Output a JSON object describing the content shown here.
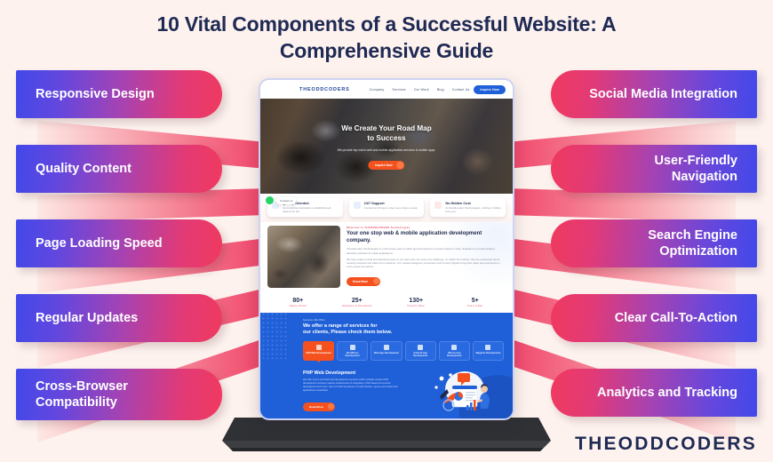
{
  "background_color": "#fdf2ee",
  "accent_blue": "#4248ea",
  "accent_pink": "#f03a5f",
  "title": "10 Vital Components of a Successful Website: A Comprehensive Guide",
  "brand": "THEODDCODERS",
  "left_items": [
    {
      "label": "Responsive Design"
    },
    {
      "label": "Quality Content"
    },
    {
      "label": "Page Loading Speed"
    },
    {
      "label": "Regular Updates"
    },
    {
      "label": "Cross-Browser Compatibility"
    }
  ],
  "right_items": [
    {
      "label": "Social Media Integration"
    },
    {
      "label": "User-Friendly Navigation"
    },
    {
      "label": "Search Engine Optimization"
    },
    {
      "label": "Clear Call-To-Action"
    },
    {
      "label": "Analytics and Tracking"
    }
  ],
  "mockup": {
    "site_logo": "THEODDCODERS",
    "nav": [
      {
        "label": "Company"
      },
      {
        "label": "Services"
      },
      {
        "label": "Our Work"
      },
      {
        "label": "Blog"
      },
      {
        "label": "Contact Us"
      }
    ],
    "nav_button": "Inquire Now",
    "hero": {
      "heading_line1": "We Create Your Road Map",
      "heading_line2": "to Success",
      "subtext": "We provide top notch web and mobile application services & mobile apps.",
      "cta": "Inquire Now"
    },
    "whatsapp_label": "Contact us",
    "cards": [
      {
        "title": "Quality Oriented",
        "text": "Accomplished standards in establishing all aspects for the."
      },
      {
        "title": "24/7 Support",
        "text": "Contact us 24 hours a day, seven days a week."
      },
      {
        "title": "No Hidden Cost",
        "text": "An flexible talent Technologies, nothing is hidden from you."
      }
    ],
    "about": {
      "eyebrow": "Welcome to THEODDCODERS Technologies",
      "heading": "Your one stop web & mobile application development company.",
      "paragraph1": "Theoddcoders Technologies is a full service web & mobile app development company based in India, dedicated to provide flawless attractive websites & mobile applications.",
      "paragraph2": "We have ready cynical and talented people on our team who can solve any challenge, no matter the industry. We are passionate about creating business and value from problems. Our creative designers, developers and content fighters bring their ideas and experience in every project as well as.",
      "button": "Know More"
    },
    "stats": [
      {
        "value": "80+",
        "label": "Happy Clients"
      },
      {
        "value": "25+",
        "label": "Designers & Developers"
      },
      {
        "value": "130+",
        "label": "Projects Done"
      },
      {
        "value": "5+",
        "label": "Years of Exp."
      }
    ],
    "services": {
      "eyebrow": "Services We Offer",
      "heading_line1": "We offer a range of services for",
      "heading_line2": "our clients, Please check them below.",
      "tabs": [
        {
          "label": "PHP Web Development",
          "active": true
        },
        {
          "label": "WordPress Development",
          "active": false
        },
        {
          "label": "Web App Development",
          "active": false
        },
        {
          "label": "Android App Development",
          "active": false
        },
        {
          "label": "iPhone App Development",
          "active": false
        },
        {
          "label": "Magento Development",
          "active": false
        }
      ]
    },
    "php": {
      "heading": "PHP Web Development",
      "paragraph": "We offer end to end PHP web development services which includes custom PHP development services, feature enhancement & integration, PHP based ecommerce development and more. Hire our PHP developers to build intuitive, secure and robust web applications & websites.",
      "button": "Read More"
    }
  }
}
